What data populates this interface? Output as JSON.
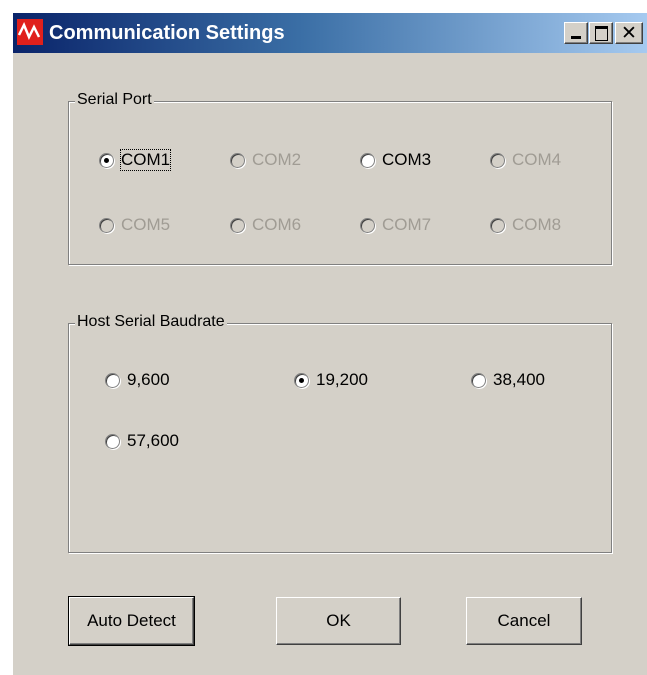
{
  "window": {
    "title": "Communication Settings",
    "icon": "waveform-app-icon"
  },
  "serial_port": {
    "label": "Serial Port",
    "options": [
      {
        "label": "COM1",
        "selected": true,
        "enabled": true
      },
      {
        "label": "COM2",
        "selected": false,
        "enabled": false
      },
      {
        "label": "COM3",
        "selected": false,
        "enabled": true
      },
      {
        "label": "COM4",
        "selected": false,
        "enabled": false
      },
      {
        "label": "COM5",
        "selected": false,
        "enabled": false
      },
      {
        "label": "COM6",
        "selected": false,
        "enabled": false
      },
      {
        "label": "COM7",
        "selected": false,
        "enabled": false
      },
      {
        "label": "COM8",
        "selected": false,
        "enabled": false
      }
    ]
  },
  "baudrate": {
    "label": "Host Serial Baudrate",
    "options": [
      {
        "label": "9,600",
        "selected": false
      },
      {
        "label": "19,200",
        "selected": true
      },
      {
        "label": "38,400",
        "selected": false
      },
      {
        "label": "57,600",
        "selected": false
      }
    ]
  },
  "buttons": {
    "auto_detect": "Auto Detect",
    "ok": "OK",
    "cancel": "Cancel"
  },
  "colors": {
    "title_gradient_start": "#0a246a",
    "title_gradient_end": "#a6caf0",
    "face": "#d4d0c8",
    "disabled_text": "#a09c94",
    "app_icon": "#e0201c"
  }
}
